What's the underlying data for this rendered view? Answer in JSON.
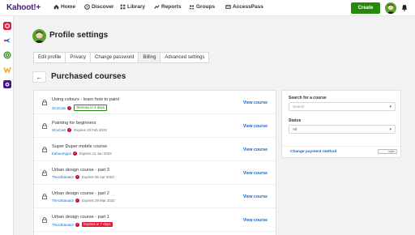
{
  "brand": {
    "logo_text": "Kahoot!+"
  },
  "nav": [
    {
      "label": "Home",
      "icon": "home-icon"
    },
    {
      "label": "Discover",
      "icon": "compass-icon"
    },
    {
      "label": "Library",
      "icon": "library-icon"
    },
    {
      "label": "Reports",
      "icon": "reports-icon"
    },
    {
      "label": "Groups",
      "icon": "groups-icon"
    },
    {
      "label": "AccessPass",
      "icon": "accesspass-icon"
    }
  ],
  "header": {
    "create_label": "Create"
  },
  "page": {
    "title": "Profile settings",
    "tabs": [
      "Edit profile",
      "Privacy",
      "Change password",
      "Billing",
      "Advanced settings"
    ],
    "active_tab": "Billing",
    "section_title": "Purchased courses",
    "back_symbol": "←"
  },
  "courses": [
    {
      "title": "Using colours - learn how to paint",
      "author": "3CoCam",
      "meta": "Renews in 2 days",
      "meta_style": "green",
      "link": "View course"
    },
    {
      "title": "Painting for beginners",
      "author": "3CoCam",
      "meta": "Expires 23 Feb 2023",
      "meta_style": "plain",
      "link": "View course"
    },
    {
      "title": "Super Duper mobile course",
      "author": "KahootApps",
      "meta": "Expires 11 Jun 2022",
      "meta_style": "plain",
      "link": "View course"
    },
    {
      "title": "Urban design course - part 3",
      "author": "TheUrbanator",
      "meta": "Expires 06 Apr 2022",
      "meta_style": "plain",
      "link": "View course"
    },
    {
      "title": "Urban design course - part 2",
      "author": "TheUrbanator",
      "meta": "Expires 29 Mar 2022",
      "meta_style": "plain",
      "link": "View course"
    },
    {
      "title": "Urban design course - part 1",
      "author": "TheUrbanator",
      "meta": "Expires in 7 days",
      "meta_style": "red",
      "link": "View course"
    }
  ],
  "filters": {
    "search_label": "Search for a course",
    "search_placeholder": "Search",
    "status_label": "Status",
    "status_value": "All",
    "payment_link": "Change payment method",
    "payment_badge": "stripe"
  },
  "colors": {
    "brand": "#46178f",
    "accent_green": "#26890c",
    "link_blue": "#1368ce",
    "alert_red": "#e21b3c"
  }
}
